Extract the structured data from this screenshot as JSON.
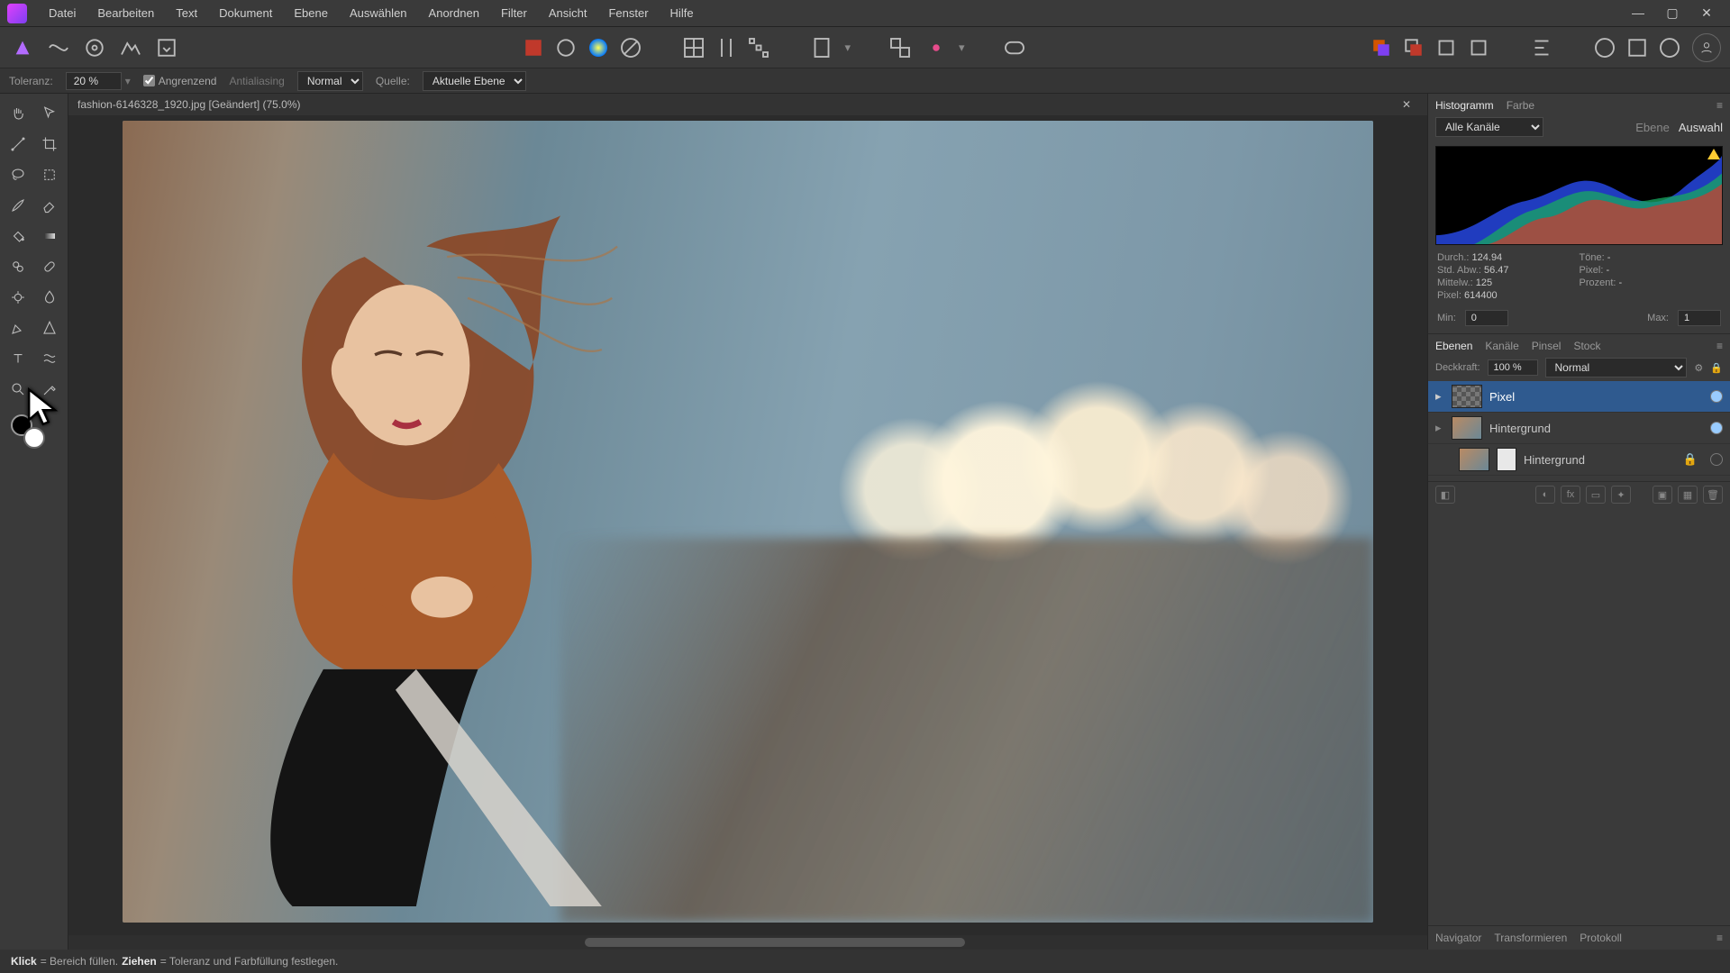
{
  "menu": [
    "Datei",
    "Bearbeiten",
    "Text",
    "Dokument",
    "Ebene",
    "Auswählen",
    "Anordnen",
    "Filter",
    "Ansicht",
    "Fenster",
    "Hilfe"
  ],
  "context": {
    "tol_label": "Toleranz:",
    "tol_value": "20 %",
    "contig_label": "Angrenzend",
    "contig_checked": true,
    "aa_label": "Antialiasing",
    "aa_checked": false,
    "blend_value": "Normal",
    "source_label": "Quelle:",
    "source_value": "Aktuelle Ebene"
  },
  "doc_tab": "fashion-6146328_1920.jpg [Geändert] (75.0%)",
  "tools": [
    "hand-icon",
    "move-icon",
    "node-icon",
    "crop-icon",
    "lasso-icon",
    "marquee-icon",
    "brush-icon",
    "erase-icon",
    "fill-icon",
    "gradient-icon",
    "clone-icon",
    "heal-icon",
    "dodge-icon",
    "blur-icon",
    "pen-icon",
    "shape-icon",
    "text-icon",
    "mesh-icon",
    "zoom-icon",
    "picker-icon"
  ],
  "right": {
    "tabs_top": [
      "Histogramm",
      "Farbe"
    ],
    "channel_label": "Alle Kanäle",
    "mode_labels": [
      "Ebene",
      "Auswahl"
    ],
    "stats": {
      "mean_label": "Durch.:",
      "mean": "124.94",
      "std_label": "Std. Abw.:",
      "std": "56.47",
      "median_label": "Mittelw.:",
      "median": "125",
      "pixels_label": "Pixel:",
      "pixels": "614400",
      "tone_label": "Töne:",
      "tone": "-",
      "pct_label": "Prozent:",
      "pct": "-",
      "px_label": "Pixel:",
      "px": "-"
    },
    "min_label": "Min:",
    "min": "0",
    "max_label": "Max:",
    "max": "1",
    "layer_tabs": [
      "Ebenen",
      "Kanäle",
      "Pinsel",
      "Stock"
    ],
    "opacity_label": "Deckkraft:",
    "opacity": "100 %",
    "blend": "Normal",
    "layers": [
      {
        "name": "Pixel",
        "selected": true
      },
      {
        "name": "Hintergrund",
        "selected": false
      },
      {
        "name": "Hintergrund",
        "selected": false,
        "locked": true,
        "indent": true
      }
    ],
    "bottom_tabs": [
      "Navigator",
      "Transformieren",
      "Protokoll"
    ]
  },
  "status": {
    "k1": "Klick",
    "t1": " = Bereich füllen. ",
    "k2": "Ziehen",
    "t2": " = Toleranz und Farbfüllung festlegen."
  },
  "colors": {
    "accent": "#2f5a8f"
  }
}
